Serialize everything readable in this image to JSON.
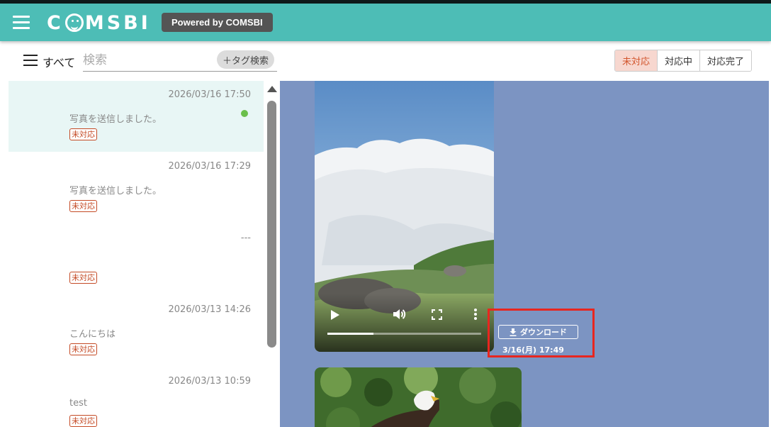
{
  "header": {
    "logo_text": "COMSBI",
    "powered_label": "Powered by COMSBI",
    "brand_color": "#4dbdb6"
  },
  "toolbar": {
    "filter_label": "すべて",
    "search_placeholder": "検索",
    "tag_search_label": "＋タグ検索",
    "status_tabs": [
      "未対応",
      "対応中",
      "対応完了"
    ],
    "selected_status": "未対応"
  },
  "conversations": [
    {
      "time": "2026/03/16 17:50",
      "message": "写真を送信しました。",
      "badge": "未対応",
      "unread": true,
      "active": true
    },
    {
      "time": "2026/03/16 17:29",
      "message": "写真を送信しました。",
      "badge": "未対応",
      "unread": false,
      "active": false
    },
    {
      "time": "---",
      "message": "",
      "badge": "未対応",
      "unread": false,
      "active": false
    },
    {
      "time": "2026/03/13 14:26",
      "message": "こんにちは",
      "badge": "未対応",
      "unread": false,
      "active": false
    },
    {
      "time": "2026/03/13 10:59",
      "message": "test",
      "badge": "未対応",
      "unread": false,
      "active": false
    }
  ],
  "chat": {
    "background_color": "#7c94c2",
    "video_message": {
      "download_label": "ダウンロード",
      "timestamp": "3/16(月) 17:49",
      "playback_progress": 0.3,
      "icons": [
        "play-icon",
        "volume-icon",
        "fullscreen-icon",
        "more-options-icon",
        "download-icon"
      ]
    },
    "highlight_color": "#e8261f"
  }
}
